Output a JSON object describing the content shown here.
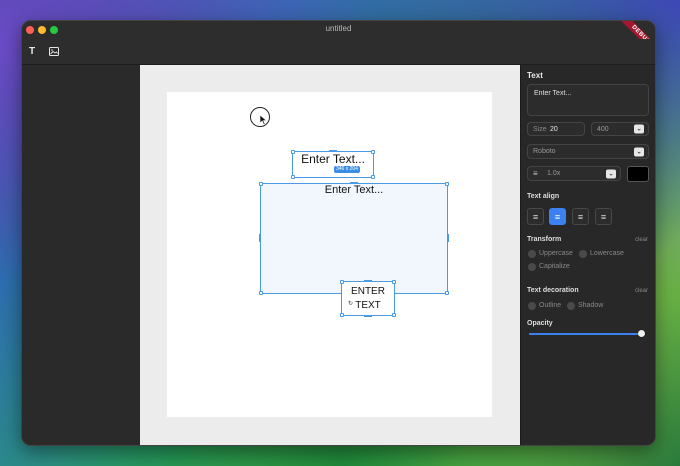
{
  "window": {
    "title": "untitled",
    "debug_ribbon": "DEBUG"
  },
  "toolbar": {
    "text_tool_label": "T"
  },
  "canvas": {
    "heading_text": "Enter Text...",
    "heading_dimensions": "346 x 204",
    "box_text": "Enter Text...",
    "upper_text_line1": "ENTER",
    "upper_text_line2": "TEXT"
  },
  "panel": {
    "section_title": "Text",
    "text_value": "Enter Text...",
    "size_label": "Size",
    "size_value": "20",
    "weight_value": "400",
    "font_value": "Roboto",
    "line_height_value": "1.0x",
    "color": "#000000",
    "text_align_label": "Text align",
    "text_align_selected": "center",
    "transform_label": "Transform",
    "transform_clear": "clear",
    "transform_options": [
      "Uppercase",
      "Lowercase",
      "Capitalize"
    ],
    "decoration_label": "Text decoration",
    "decoration_clear": "clear",
    "decoration_options": [
      "Outline",
      "Shadow"
    ],
    "opacity_label": "Opacity",
    "opacity_value": 1.0
  },
  "colors": {
    "accent": "#3b82f0",
    "selection": "#4a9ae6"
  }
}
